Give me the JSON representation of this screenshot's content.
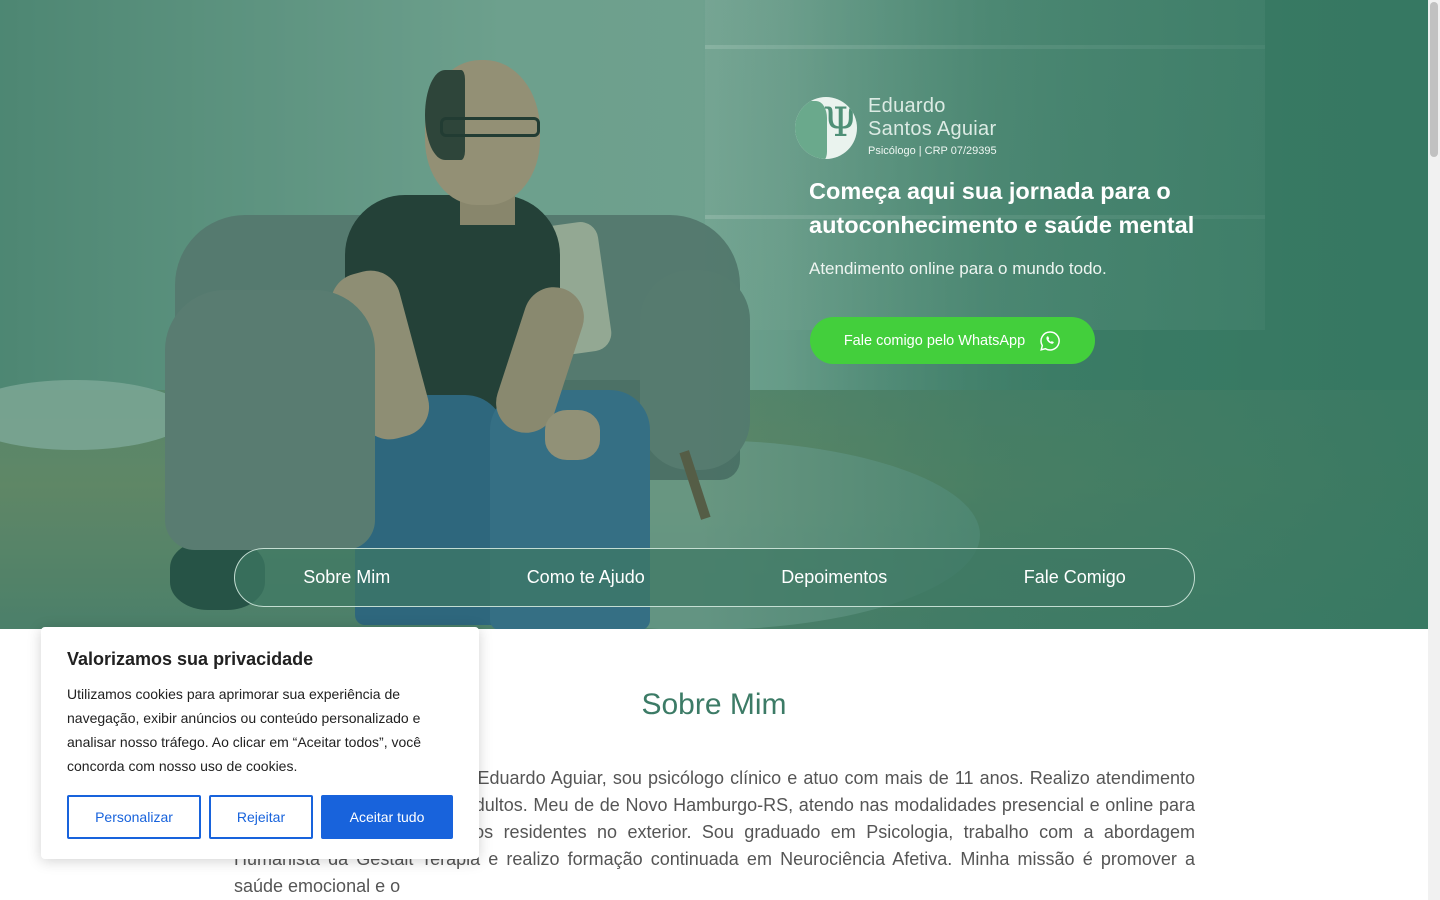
{
  "brand": {
    "name_line1": "Eduardo",
    "name_line2": "Santos Aguiar",
    "subtitle": "Psicólogo | CRP 07/29395",
    "logo_glyph": "Ψ"
  },
  "hero": {
    "headline": "Começa aqui sua jornada para o autoconhecimento e saúde mental",
    "subheadline": "Atendimento online para o mundo todo.",
    "cta_label": "Fale comigo pelo WhatsApp",
    "cta_icon": "whatsapp-icon",
    "cta_color": "#43cf3c"
  },
  "nav": {
    "items": [
      {
        "label": "Sobre Mim"
      },
      {
        "label": "Como te Ajudo"
      },
      {
        "label": "Depoimentos"
      },
      {
        "label": "Fale Comigo"
      }
    ]
  },
  "about": {
    "title": "Sobre Mim",
    "visible_text": "stória profissional. Me chamo Eduardo Aguiar, sou psicólogo clínico e atuo com mais de 11 anos. Realizo atendimento de crianças, adolescentes e adultos. Meu de de Novo Hamburgo-RS, atendo nas modalidades presencial e online para todo o país e para brasileiros residentes no exterior. Sou graduado em Psicologia, trabalho com a abordagem Humanista da Gestalt Terapia e realizo formação continuada em Neurociência Afetiva. Minha missão é promover a saúde emocional e o"
  },
  "cookie": {
    "title": "Valorizamos sua privacidade",
    "text": "Utilizamos cookies para aprimorar sua experiência de navegação, exibir anúncios ou conteúdo personalizado e analisar nosso tráfego. Ao clicar em “Aceitar todos”, você concorda com nosso uso de cookies.",
    "customize_label": "Personalizar",
    "reject_label": "Rejeitar",
    "accept_label": "Aceitar tudo",
    "accent_color": "#1863dc"
  },
  "colors": {
    "brand_green": "#3c7b66",
    "hero_overlay": "#3f7a66"
  }
}
